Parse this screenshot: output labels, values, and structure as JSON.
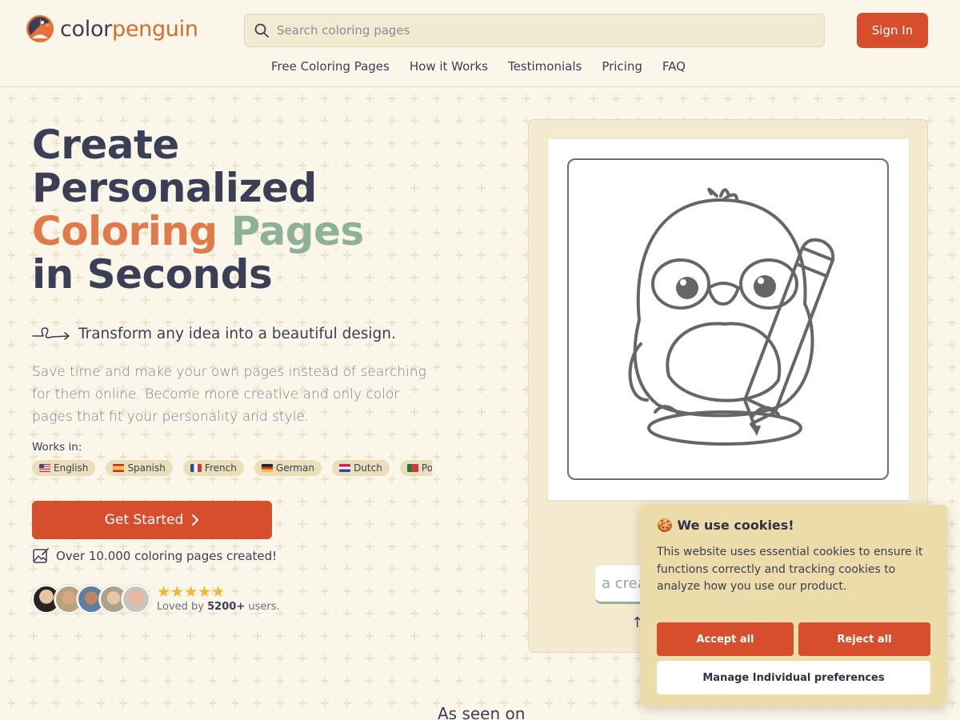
{
  "brand": {
    "name_part1": "color",
    "name_part2": "penguin"
  },
  "search": {
    "placeholder": "Search coloring pages"
  },
  "header": {
    "signin_label": "Sign In"
  },
  "nav": {
    "items": [
      {
        "label": "Free Coloring Pages"
      },
      {
        "label": "How it Works"
      },
      {
        "label": "Testimonials"
      },
      {
        "label": "Pricing"
      },
      {
        "label": "FAQ"
      }
    ]
  },
  "hero": {
    "title_line1": "Create",
    "title_line2": "Personalized",
    "title_line3a": "Coloring",
    "title_line3b": "Pages",
    "title_line4": "in Seconds",
    "tagline": "Transform any idea into a beautiful design.",
    "description": "Save time and make your own pages instead of searching for them online. Become more creative and only color pages that fit your personality and style.",
    "works_in_label": "Works in:",
    "languages": [
      {
        "label": "English",
        "flag": "us"
      },
      {
        "label": "Spanish",
        "flag": "es"
      },
      {
        "label": "French",
        "flag": "fr"
      },
      {
        "label": "German",
        "flag": "de"
      },
      {
        "label": "Dutch",
        "flag": "nl"
      },
      {
        "label": "Por",
        "flag": "pt"
      }
    ],
    "cta_label": "Get Started",
    "created_text": "Over 10.000 coloring pages created!",
    "rating": {
      "stars": 5,
      "loved_prefix": "Loved by",
      "count": "5200+",
      "loved_suffix": "users."
    }
  },
  "preview": {
    "image_icon": "penguin-with-pencil-line-art",
    "prompt_text": "a crea",
    "arrow": "↑"
  },
  "cookie": {
    "emoji": "🍪",
    "title": "We use cookies!",
    "body": "This website uses essential cookies to ensure it functions correctly and tracking cookies to analyze how you use our product.",
    "accept_label": "Accept all",
    "reject_label": "Reject all",
    "manage_label": "Manage Individual preferences"
  },
  "footer": {
    "seen_on": "As seen on"
  },
  "colors": {
    "accent": "#d64e2b",
    "background": "#faf6ea",
    "text": "#3b3f56",
    "star": "#f1b82e",
    "cookie_bg": "#ecdcaa"
  }
}
